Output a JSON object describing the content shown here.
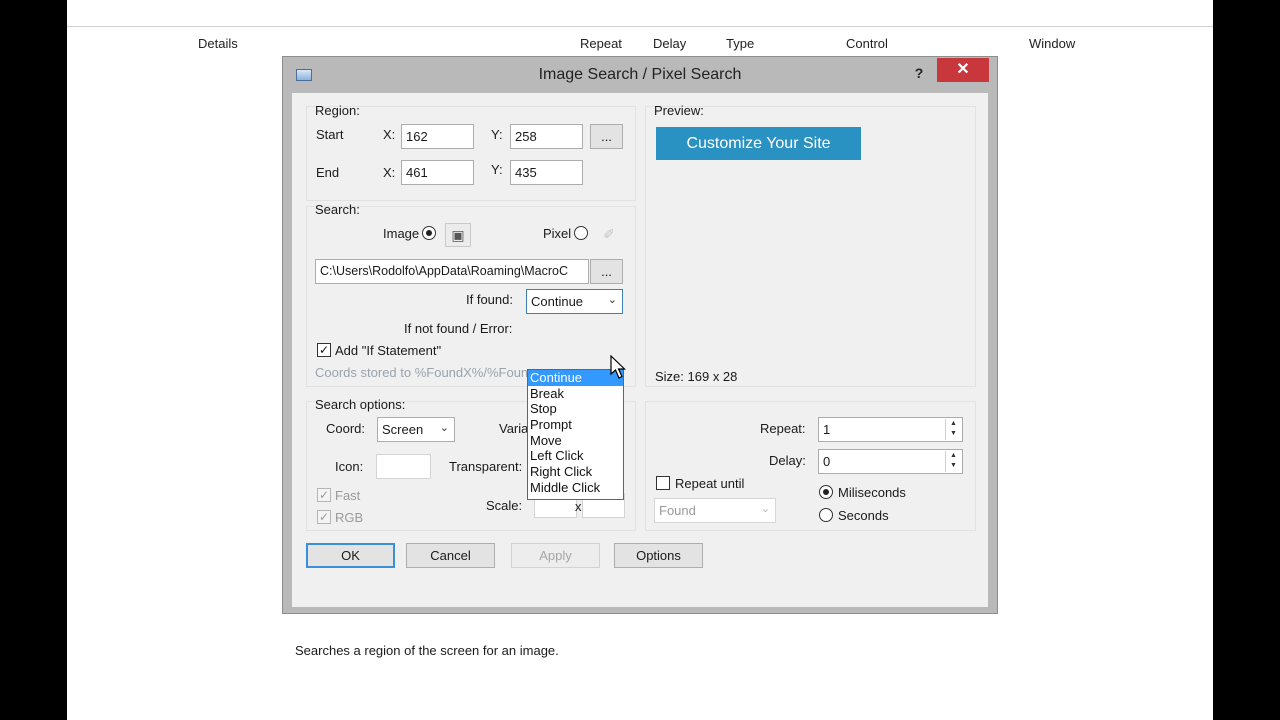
{
  "columns": [
    "Details",
    "Repeat",
    "Delay",
    "Type",
    "Control",
    "Window"
  ],
  "dialog": {
    "title": "Image Search / Pixel Search",
    "help_label": "?",
    "close_label": "✕",
    "region_label": "Region:",
    "start_label": "Start",
    "end_label": "End",
    "x_label": "X:",
    "y_label": "Y:",
    "start_x": "162",
    "start_y": "258",
    "end_x": "461",
    "end_y": "435",
    "browse_label": "...",
    "search_label": "Search:",
    "image_label": "Image",
    "pixel_label": "Pixel",
    "path_value": "C:\\Users\\Rodolfo\\AppData\\Roaming\\MacroC",
    "if_found_label": "If found:",
    "if_found_value": "Continue",
    "if_not_found_label": "If not found / Error:",
    "add_if_label": "Add \"If Statement\"",
    "coords_label": "Coords stored to %FoundX%/%Found",
    "dropdown_options": [
      "Continue",
      "Break",
      "Stop",
      "Prompt",
      "Move",
      "Left Click",
      "Right Click",
      "Middle Click"
    ],
    "search_options_label": "Search options:",
    "coord_label": "Coord:",
    "coord_value": "Screen",
    "variation_label": "Varia",
    "icon_label": "Icon:",
    "transparent_label": "Transparent:",
    "fast_label": "Fast",
    "rgb_label": "RGB",
    "scale_label": "Scale:",
    "scale_x": "x",
    "preview_label": "Preview:",
    "preview_text": "Customize Your Site",
    "size_label": "Size: 169 x 28",
    "repeat_label": "Repeat:",
    "repeat_value": "1",
    "delay_label": "Delay:",
    "delay_value": "0",
    "repeat_until_label": "Repeat until",
    "found_value": "Found",
    "miliseconds_label": "Miliseconds",
    "seconds_label": "Seconds",
    "ok_label": "OK",
    "cancel_label": "Cancel",
    "apply_label": "Apply",
    "options_label": "Options",
    "status_text": "Searches a region of the screen for an image."
  }
}
